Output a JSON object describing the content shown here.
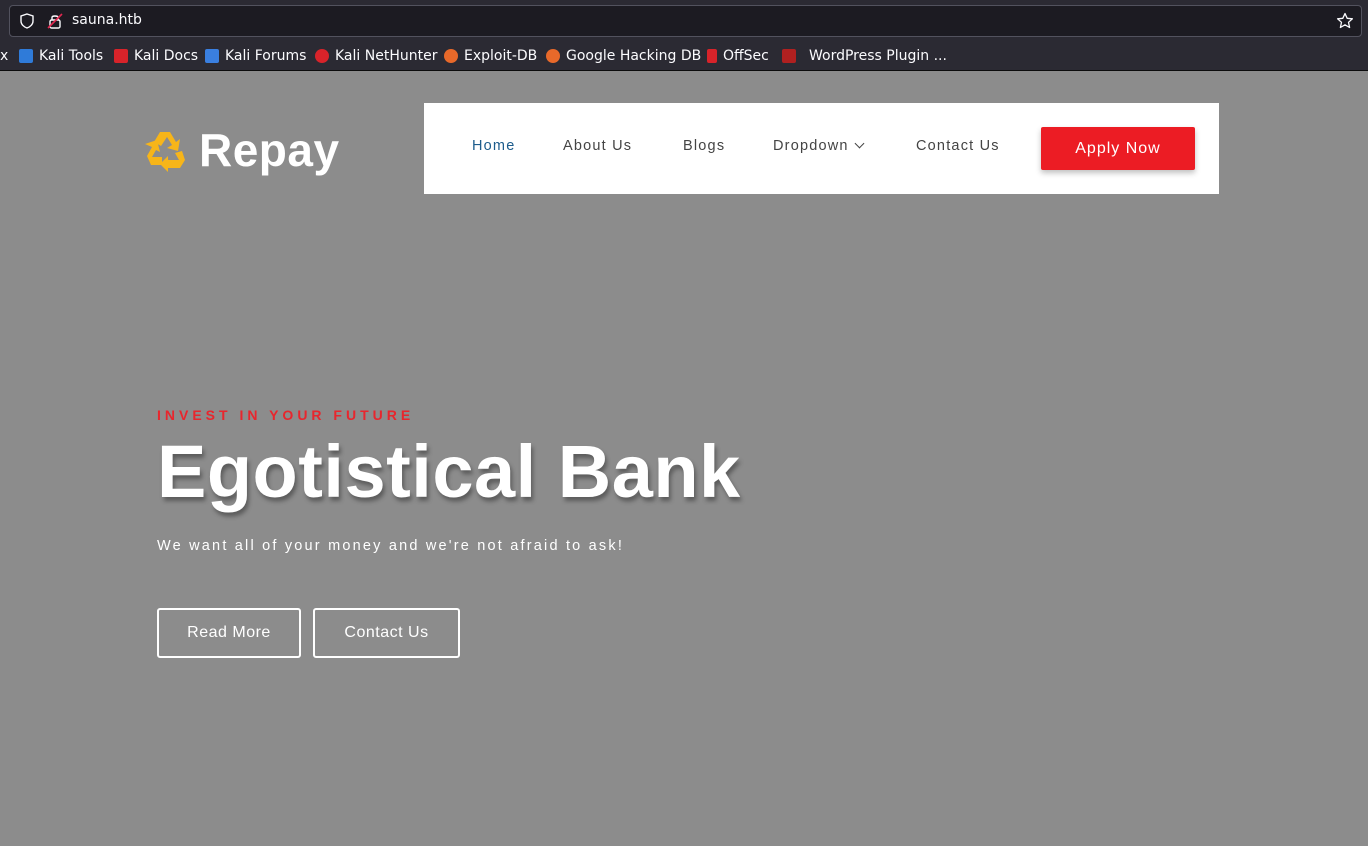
{
  "browser": {
    "url": "sauna.htb",
    "bookmarks": [
      {
        "label": "x",
        "icon": "cut-off-icon",
        "color": ""
      },
      {
        "label": "Kali Tools",
        "icon": "kali-tools-icon",
        "color": "#2f7bd9"
      },
      {
        "label": "Kali Docs",
        "icon": "kali-docs-icon",
        "color": "#d8232a"
      },
      {
        "label": "Kali Forums",
        "icon": "kali-forums-icon",
        "color": "#3a7fe0"
      },
      {
        "label": "Kali NetHunter",
        "icon": "kali-nethunter-icon",
        "color": "#d8232a"
      },
      {
        "label": "Exploit-DB",
        "icon": "exploit-db-icon",
        "color": "#e8692a"
      },
      {
        "label": "Google Hacking DB",
        "icon": "ghdb-icon",
        "color": "#e8692a"
      },
      {
        "label": "OffSec",
        "icon": "offsec-icon",
        "color": "#d8232a"
      },
      {
        "label": "WordPress Plugin ...",
        "icon": "wordpress-plugin-icon",
        "color": "#b02020"
      }
    ]
  },
  "site": {
    "logo_text": "Repay",
    "nav": [
      {
        "label": "Home",
        "active": true
      },
      {
        "label": "About Us"
      },
      {
        "label": "Blogs"
      },
      {
        "label": "Dropdown"
      },
      {
        "label": "Contact Us"
      }
    ],
    "cta_label": "Apply Now",
    "hero": {
      "kicker": "INVEST IN YOUR FUTURE",
      "title": "Egotistical Bank",
      "subtitle": "We want all of your money and we're not afraid to ask!",
      "primary_button": "Read More",
      "secondary_button": "Contact Us"
    }
  },
  "colors": {
    "accent_red": "#ec1c24",
    "nav_active": "#1d5c8c",
    "logo_yellow": "#f7b519",
    "page_bg": "#8c8c8c"
  }
}
